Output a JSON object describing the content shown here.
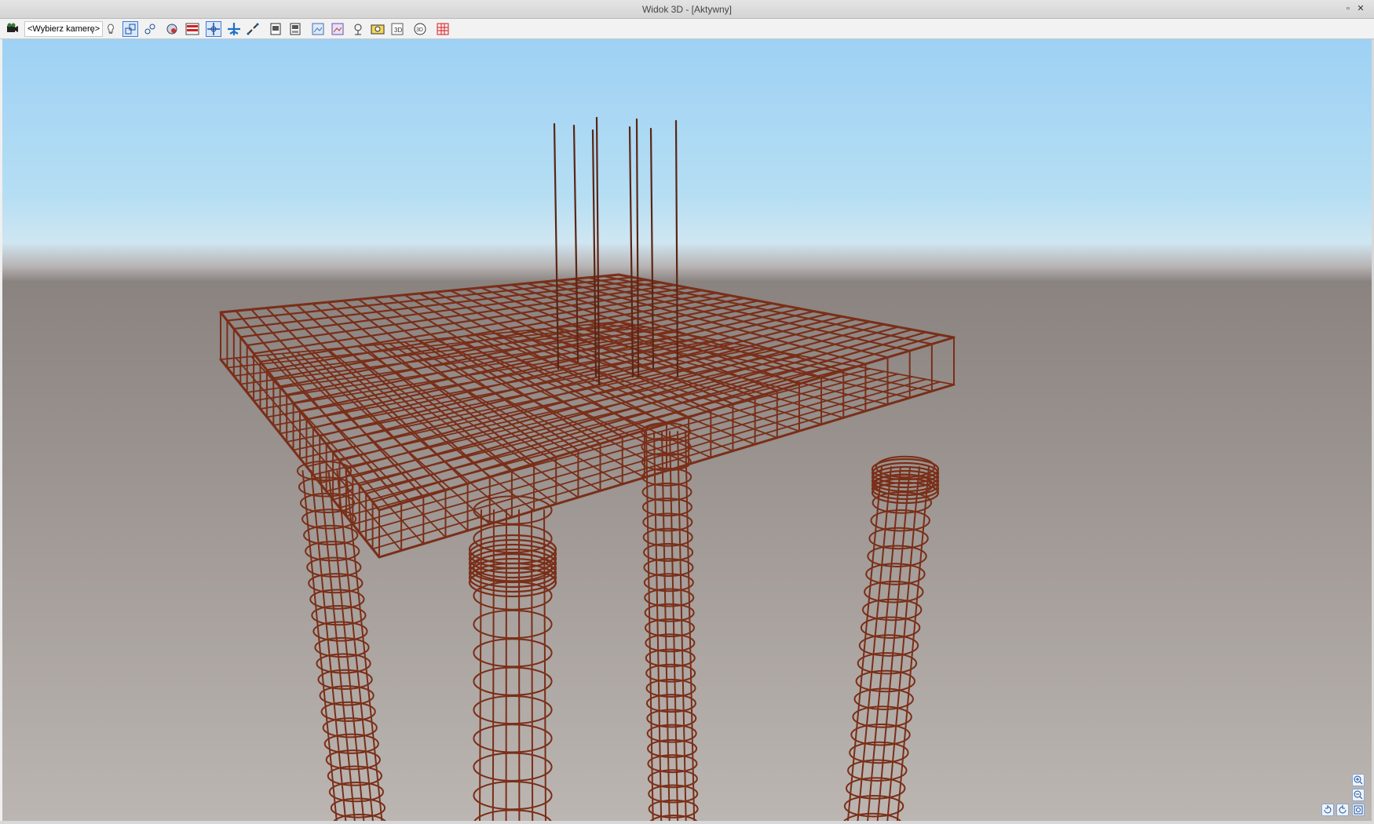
{
  "window": {
    "title": "Widok 3D - [Aktywny]"
  },
  "toolbar": {
    "camera_select_value": "<Wybierz kamerę>",
    "buttons": [
      "camera-icon",
      "light-icon",
      "select-objects-icon",
      "select-objects-alt-icon",
      "render-icon",
      "wall-layers-icon",
      "pan-icon",
      "fly-icon",
      "walk-icon",
      "print-icon",
      "print-preview-icon",
      "export-image-icon",
      "export-image-alt-icon",
      "camera-path-icon",
      "photo-icon",
      "3d-object-icon",
      "3d-rotate-icon",
      "grid-settings-icon"
    ]
  },
  "viewport": {
    "sky_top": "#9ed1f4",
    "sky_horizon": "#cfe6f2",
    "ground": "#9a9390",
    "rebar_color": "#7a2e18",
    "scene": "3d-reinforcement-frame"
  },
  "zoom_tools": [
    "zoom-in-icon",
    "zoom-out-icon",
    "rotate-left-icon",
    "rotate-right-icon",
    "zoom-extents-icon"
  ]
}
